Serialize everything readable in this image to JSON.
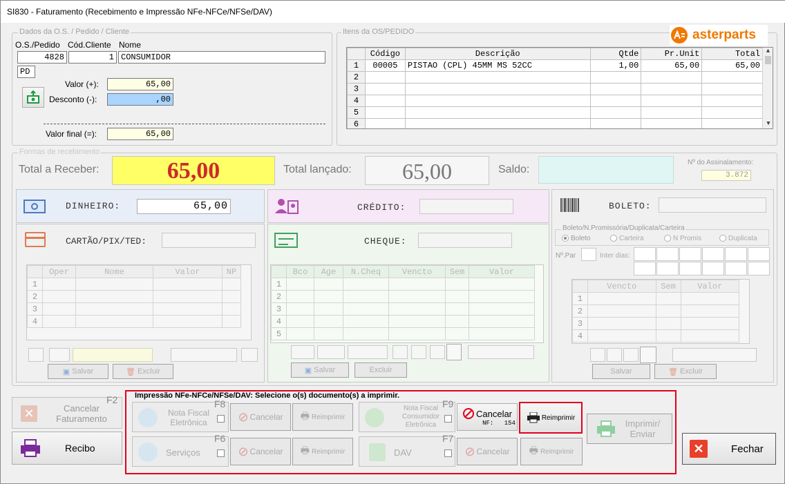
{
  "window": {
    "title": "SI830 - Faturamento (Recebimento e Impressão NFe-NFCe/NFSe/DAV)"
  },
  "os_frame": {
    "title": "Dados da O.S. / Pedido / Cliente",
    "col_labels": {
      "os": "O.S./Pedido",
      "cliente": "Cód.Cliente",
      "nome": "Nome"
    },
    "os_number": "4828",
    "client_code": "1",
    "client_name": "CONSUMIDOR",
    "type": "PD",
    "valor_label": "Valor (+):",
    "valor": "65,00",
    "desconto_label": "Desconto (-):",
    "desconto": ",00",
    "final_label": "Valor final (=):",
    "valor_final": "65,00"
  },
  "itens_frame": {
    "title": "Itens da OS/PEDIDO",
    "brand": "asterparts",
    "columns": [
      "Código",
      "Descrição",
      "Qtde",
      "Pr.Unit",
      "Total"
    ],
    "rows": [
      {
        "n": "1",
        "codigo": "00005",
        "descricao": "PISTAO (CPL) 45MM MS 52CC",
        "qtde": "1,00",
        "unit": "65,00",
        "total": "65,00"
      },
      {
        "n": "2",
        "codigo": "",
        "descricao": "",
        "qtde": "",
        "unit": "",
        "total": ""
      },
      {
        "n": "3",
        "codigo": "",
        "descricao": "",
        "qtde": "",
        "unit": "",
        "total": ""
      },
      {
        "n": "4",
        "codigo": "",
        "descricao": "",
        "qtde": "",
        "unit": "",
        "total": ""
      },
      {
        "n": "5",
        "codigo": "",
        "descricao": "",
        "qtde": "",
        "unit": "",
        "total": ""
      },
      {
        "n": "6",
        "codigo": "",
        "descricao": "",
        "qtde": "",
        "unit": "",
        "total": ""
      }
    ]
  },
  "formas": {
    "title": "Formas de recebimento",
    "total_receber_label": "Total a Receber:",
    "total_receber": "65,00",
    "total_lancado_label": "Total lançado:",
    "total_lancado": "65,00",
    "saldo_label": "Saldo:",
    "assinalamento_label": "Nº do Assinalamento:",
    "assinalamento": "3.872",
    "dinheiro_label": "DINHEIRO:",
    "dinheiro": "65,00",
    "credito_label": "CRÉDITO:",
    "boleto_label": "BOLETO:",
    "cartao_label": "CARTÃO/PIX/TED:",
    "cheque_label": "CHEQUE:",
    "cartao_cols": [
      "Oper",
      "Nome",
      "Valor",
      "NP"
    ],
    "cheque_cols": [
      "Bco",
      "Age",
      "N.Cheq",
      "Vencto",
      "Sem",
      "Valor"
    ],
    "boleto_group_title": "Boleto/N.Promissória/Duplicata/Carteira",
    "radio_options": [
      "Boleto",
      "Carteira",
      "N Promis",
      "Duplicata"
    ],
    "npar_label": "Nº.Par",
    "intervalo_label": "Inter dias:",
    "boleto_cols": [
      "Vencto",
      "Sem",
      "Valor"
    ],
    "salvar": "Salvar",
    "excluir": "Excluir"
  },
  "impressao": {
    "title": "Impressão NFe-NFCe/NFSe/DAV: Selecione o(s) documento(s) a imprimir.",
    "nfe_label": "Nota Fiscal Eletrônica",
    "nfe_key": "F8",
    "nfce_label": "Nota Fiscal Consumidor Eletrônica",
    "nfce_key": "F9",
    "servicos_label": "Serviços",
    "servicos_key": "F6",
    "dav_label": "DAV",
    "dav_key": "F7",
    "cancelar": "Cancelar",
    "reimprimir": "Reimprimir",
    "nf_label": "NF:",
    "nf_number": "154",
    "imprimir_enviar": "Imprimir/ Enviar"
  },
  "left_buttons": {
    "cancelar_faturamento": "Cancelar Faturamento",
    "key": "F2",
    "recibo": "Recibo"
  },
  "fechar": "Fechar",
  "colors": {
    "total_bg": "#ffff66",
    "total_fg": "#cc2a2a",
    "highlight": "#e0001a",
    "brand": "#f07800"
  }
}
